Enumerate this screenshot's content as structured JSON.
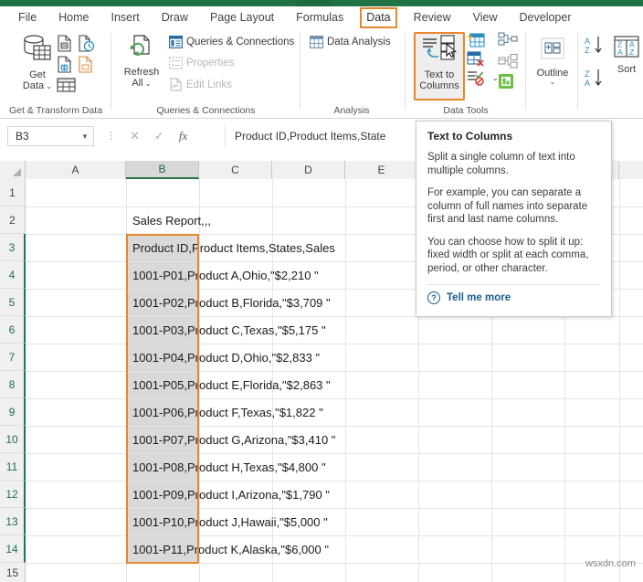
{
  "ribbon": {
    "tabs": [
      {
        "label": "File",
        "active": false
      },
      {
        "label": "Home",
        "active": false
      },
      {
        "label": "Insert",
        "active": false
      },
      {
        "label": "Draw",
        "active": false
      },
      {
        "label": "Page Layout",
        "active": false
      },
      {
        "label": "Formulas",
        "active": false
      },
      {
        "label": "Data",
        "active": true
      },
      {
        "label": "Review",
        "active": false
      },
      {
        "label": "View",
        "active": false
      },
      {
        "label": "Developer",
        "active": false
      }
    ],
    "groups": {
      "get_transform": {
        "label": "Get & Transform Data",
        "get_data_label_1": "Get",
        "get_data_label_2": "Data",
        "icons": [
          "database-icon",
          "from-text-csv-icon",
          "from-recent-sources-icon",
          "from-web-icon",
          "from-workbook-icon",
          "from-table-range-icon"
        ]
      },
      "queries": {
        "label": "Queries & Connections",
        "refresh_label_1": "Refresh",
        "refresh_label_2": "All",
        "items": [
          {
            "label": "Queries & Connections",
            "icon": "queries-connections-icon",
            "disabled": false
          },
          {
            "label": "Properties",
            "icon": "properties-icon",
            "disabled": true
          },
          {
            "label": "Edit Links",
            "icon": "edit-links-icon",
            "disabled": true
          }
        ]
      },
      "analysis": {
        "label": "Analysis",
        "items": [
          {
            "label": "Data Analysis",
            "icon": "data-analysis-icon"
          }
        ]
      },
      "data_tools": {
        "label": "Data Tools",
        "text_to_columns_label_1": "Text to",
        "text_to_columns_label_2": "Columns",
        "icons": [
          "flash-fill-icon",
          "remove-duplicates-icon",
          "data-validation-icon",
          "consolidate-icon",
          "relationships-icon",
          "manage-data-model-icon"
        ]
      },
      "outline": {
        "label": "",
        "outline_label": "Outline"
      },
      "sort_filter": {
        "sort_az_label": "A-Z-sort",
        "sort_za_label": "Z-A-sort",
        "sort_label": "Sort"
      }
    }
  },
  "formula_bar": {
    "name_box_value": "B3",
    "cancel_icon": "close-icon",
    "confirm_icon": "check-icon",
    "function_icon": "fx-icon",
    "formula_value": "Product ID,Product Items,State"
  },
  "tooltip": {
    "title": "Text to Columns",
    "paragraph_1": "Split a single column of text into multiple columns.",
    "paragraph_2": "For example, you can separate a column of full names into separate first and last name columns.",
    "paragraph_3": "You can choose how to split it up: fixed width or split at each comma, period, or other character.",
    "tell_me_more": "Tell me more",
    "help_icon": "question-circle-icon"
  },
  "sheet": {
    "column_headers": [
      "A",
      "B",
      "C",
      "D",
      "E"
    ],
    "selected_column": "B",
    "row_headers": [
      "1",
      "2",
      "3",
      "4",
      "5",
      "6",
      "7",
      "8",
      "9",
      "10",
      "11",
      "12",
      "13",
      "14",
      "15"
    ],
    "cells": [
      {
        "row": 2,
        "text": "Sales Report,,,"
      },
      {
        "row": 3,
        "text": "Product ID,Product Items,States,Sales"
      },
      {
        "row": 4,
        "text": "1001-P01,Product A,Ohio,\"$2,210 \""
      },
      {
        "row": 5,
        "text": "1001-P02,Product B,Florida,\"$3,709 \""
      },
      {
        "row": 6,
        "text": "1001-P03,Product C,Texas,\"$5,175 \""
      },
      {
        "row": 7,
        "text": "1001-P04,Product D,Ohio,\"$2,833 \""
      },
      {
        "row": 8,
        "text": "1001-P05,Product E,Florida,\"$2,863 \""
      },
      {
        "row": 9,
        "text": "1001-P06,Product F,Texas,\"$1,822 \""
      },
      {
        "row": 10,
        "text": "1001-P07,Product G,Arizona,\"$3,410 \""
      },
      {
        "row": 11,
        "text": "1001-P08,Product H,Texas,\"$4,800 \""
      },
      {
        "row": 12,
        "text": "1001-P09,Product I,Arizona,\"$1,790 \""
      },
      {
        "row": 13,
        "text": "1001-P10,Product J,Hawaii,\"$5,000 \""
      },
      {
        "row": 14,
        "text": "1001-P11,Product K,Alaska,\"$6,000 \""
      }
    ]
  },
  "watermark": "wsxdn.com",
  "colors": {
    "excel_green": "#217346",
    "highlight_orange": "#e8862a",
    "selection_shade": "#d9d9d9",
    "link_blue": "#1a5b8c"
  }
}
